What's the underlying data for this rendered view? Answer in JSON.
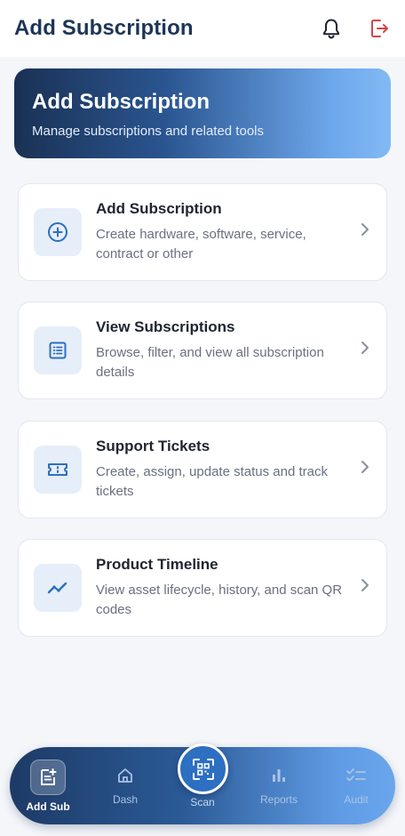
{
  "header": {
    "title": "Add Subscription"
  },
  "hero": {
    "title": "Add Subscription",
    "subtitle": "Manage subscriptions and related tools"
  },
  "cards": [
    {
      "title": "Add Subscription",
      "description": "Create hardware, software, service, contract or other",
      "icon": "plus-circle-icon"
    },
    {
      "title": "View Subscriptions",
      "description": "Browse, filter, and view all subscription details",
      "icon": "list-icon"
    },
    {
      "title": "Support Tickets",
      "description": "Create, assign, update status and track tickets",
      "icon": "ticket-icon"
    },
    {
      "title": "Product Timeline",
      "description": "View asset lifecycle, history, and scan QR codes",
      "icon": "trend-icon"
    }
  ],
  "bottom_nav": {
    "items": [
      {
        "label": "Add Sub",
        "icon": "add-document-icon",
        "active": true
      },
      {
        "label": "Dash",
        "icon": "home-icon",
        "active": false
      },
      {
        "label": "Scan",
        "icon": "qr-scan-icon",
        "active": false
      },
      {
        "label": "Reports",
        "icon": "bar-chart-icon",
        "active": false
      },
      {
        "label": "Audit",
        "icon": "checklist-icon",
        "active": false
      }
    ]
  },
  "colors": {
    "accent": "#2d6fc0",
    "title": "#1d3557",
    "logout": "#d64545"
  }
}
